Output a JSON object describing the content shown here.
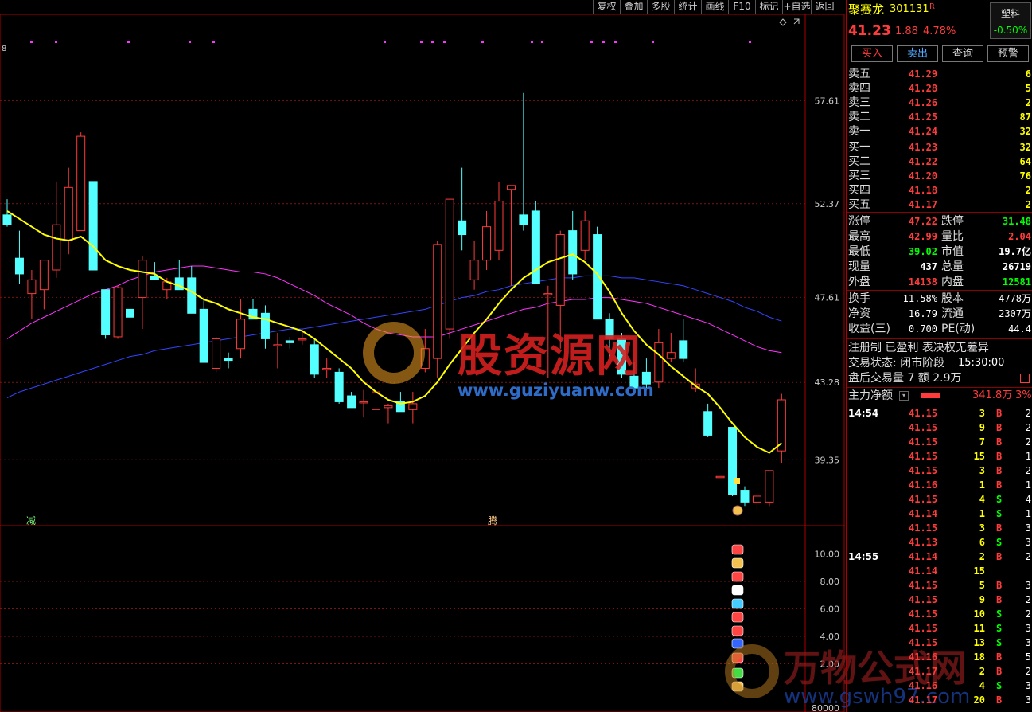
{
  "toolbar": {
    "items": [
      "复权",
      "叠加",
      "多股",
      "统计",
      "画线",
      "F10",
      "标记",
      "+自选",
      "返回"
    ]
  },
  "chart": {
    "top_left_digit": "8",
    "left_marker_label": "减",
    "mid_marker_label": "腾",
    "price_ticks": [
      "57.61",
      "52.37",
      "47.61",
      "43.28",
      "39.35"
    ],
    "sub_ticks": [
      "10.00",
      "8.00",
      "6.00",
      "4.00",
      "2.00",
      "80000"
    ],
    "colors": {
      "up": "#ff3b3b",
      "down": "#54ffff",
      "ma_short": "#ffff00",
      "ma_mid": "#ff33ff",
      "ma_long": "#3344ff",
      "grid": "#7a1414"
    }
  },
  "chart_data": {
    "type": "candlestick",
    "title": "",
    "ylim": [
      36.0,
      62.0
    ],
    "candles": [
      [
        51.8,
        52.6,
        51.2,
        51.3
      ],
      [
        49.6,
        51.0,
        48.3,
        48.8
      ],
      [
        47.8,
        49.0,
        46.5,
        48.5
      ],
      [
        48.0,
        49.5,
        47.0,
        49.5
      ],
      [
        49.0,
        53.5,
        48.6,
        51.3
      ],
      [
        50.5,
        54.2,
        49.8,
        53.2
      ],
      [
        51.0,
        56.0,
        51.0,
        55.8
      ],
      [
        53.5,
        53.5,
        49.0,
        49.0
      ],
      [
        48.0,
        48.0,
        45.5,
        45.7
      ],
      [
        45.6,
        48.2,
        45.5,
        48.1
      ],
      [
        47.0,
        47.5,
        46.0,
        46.6
      ],
      [
        47.6,
        49.7,
        46.0,
        49.5
      ],
      [
        48.7,
        49.4,
        48.5,
        48.5
      ],
      [
        48.0,
        48.6,
        47.5,
        48.4
      ],
      [
        48.6,
        49.5,
        48.0,
        48.0
      ],
      [
        48.6,
        49.2,
        46.8,
        46.8
      ],
      [
        47.0,
        47.5,
        44.3,
        44.3
      ],
      [
        44.0,
        45.6,
        43.8,
        45.5
      ],
      [
        44.5,
        44.8,
        44.0,
        44.4
      ],
      [
        45.0,
        47.5,
        44.5,
        46.5
      ],
      [
        47.0,
        47.5,
        46.5,
        46.5
      ],
      [
        46.8,
        47.2,
        45.0,
        45.5
      ],
      [
        45.2,
        45.8,
        44.0,
        45.2
      ],
      [
        45.4,
        45.6,
        45.0,
        45.3
      ],
      [
        45.5,
        46.0,
        45.2,
        45.5
      ],
      [
        45.2,
        45.5,
        43.5,
        43.7
      ],
      [
        44.0,
        44.5,
        43.5,
        44.0
      ],
      [
        43.8,
        44.0,
        42.2,
        42.3
      ],
      [
        42.6,
        42.8,
        42.0,
        42.0
      ],
      [
        42.3,
        42.9,
        41.5,
        42.3
      ],
      [
        41.9,
        42.8,
        41.7,
        42.8
      ],
      [
        42.0,
        42.2,
        41.2,
        42.1
      ],
      [
        42.3,
        42.8,
        41.8,
        41.8
      ],
      [
        41.9,
        42.8,
        41.2,
        42.2
      ],
      [
        44.0,
        46.0,
        43.8,
        45.0
      ],
      [
        44.5,
        50.5,
        43.5,
        50.3
      ],
      [
        46.0,
        52.6,
        45.5,
        52.6
      ],
      [
        51.5,
        54.2,
        50.0,
        50.8
      ],
      [
        48.5,
        50.5,
        48.0,
        49.5
      ],
      [
        49.5,
        52.0,
        49.0,
        51.2
      ],
      [
        50.0,
        53.5,
        49.5,
        52.5
      ],
      [
        53.1,
        53.2,
        48.2,
        53.3
      ],
      [
        51.8,
        58.0,
        51.0,
        51.3
      ],
      [
        52.0,
        52.5,
        48.3,
        48.3
      ],
      [
        47.8,
        48.2,
        43.5,
        47.8
      ],
      [
        47.2,
        51.0,
        45.0,
        50.8
      ],
      [
        51.0,
        52.0,
        48.5,
        48.8
      ],
      [
        50.0,
        52.0,
        49.5,
        51.5
      ],
      [
        50.8,
        51.2,
        46.5,
        46.5
      ],
      [
        46.5,
        46.8,
        44.5,
        45.5
      ],
      [
        45.5,
        45.8,
        43.5,
        43.7
      ],
      [
        43.6,
        44.3,
        43.0,
        43.0
      ],
      [
        43.8,
        44.5,
        43.0,
        43.2
      ],
      [
        43.3,
        46.0,
        43.0,
        45.3
      ],
      [
        44.5,
        45.8,
        44.3,
        44.8
      ],
      [
        45.4,
        46.5,
        44.3,
        44.5
      ],
      [
        43.0,
        44.0,
        42.8,
        43.2
      ],
      [
        41.8,
        42.2,
        40.5,
        40.6
      ],
      [
        38.5,
        38.5,
        38.5,
        38.5
      ],
      [
        41.0,
        41.0,
        37.5,
        37.6
      ],
      [
        37.8,
        38.0,
        37.0,
        37.2
      ],
      [
        37.2,
        37.6,
        36.8,
        37.5
      ],
      [
        37.2,
        38.8,
        37.0,
        38.8
      ],
      [
        39.8,
        42.7,
        39.2,
        42.4
      ]
    ],
    "ma_short": [
      52.0,
      51.6,
      51.2,
      50.8,
      50.6,
      50.5,
      50.7,
      50.2,
      49.5,
      49.2,
      49.0,
      48.9,
      48.8,
      48.4,
      48.2,
      47.9,
      47.5,
      47.3,
      47.0,
      46.8,
      46.6,
      46.5,
      46.3,
      46.1,
      45.9,
      45.5,
      45.0,
      44.5,
      44.0,
      43.3,
      42.8,
      42.4,
      42.2,
      42.3,
      42.6,
      43.3,
      44.2,
      45.0,
      45.8,
      46.5,
      47.3,
      48.0,
      48.6,
      49.0,
      49.4,
      49.6,
      49.8,
      49.4,
      48.8,
      47.9,
      46.8,
      45.9,
      45.2,
      44.7,
      44.1,
      43.6,
      43.1,
      42.7,
      42.0,
      41.2,
      40.5,
      40.0,
      39.7,
      40.2
    ],
    "ma_mid": [
      45.5,
      45.9,
      46.3,
      46.6,
      46.9,
      47.2,
      47.5,
      47.8,
      48.0,
      48.2,
      48.5,
      48.7,
      48.9,
      49.0,
      49.1,
      49.2,
      49.2,
      49.1,
      49.0,
      48.9,
      48.9,
      48.8,
      48.6,
      48.3,
      48.0,
      47.7,
      47.3,
      47.0,
      46.7,
      46.3,
      46.0,
      45.8,
      45.7,
      45.6,
      45.6,
      45.6,
      45.8,
      46.0,
      46.2,
      46.4,
      46.6,
      46.8,
      47.0,
      47.1,
      47.3,
      47.4,
      47.5,
      47.5,
      47.6,
      47.6,
      47.5,
      47.4,
      47.3,
      47.1,
      46.9,
      46.7,
      46.5,
      46.3,
      46.0,
      45.7,
      45.4,
      45.1,
      44.9,
      44.8
    ],
    "ma_long": [
      42.5,
      42.8,
      43.0,
      43.2,
      43.4,
      43.6,
      43.8,
      44.0,
      44.2,
      44.4,
      44.6,
      44.7,
      44.9,
      45.0,
      45.1,
      45.2,
      45.3,
      45.4,
      45.5,
      45.6,
      45.7,
      45.8,
      45.9,
      46.0,
      46.0,
      46.1,
      46.2,
      46.3,
      46.4,
      46.5,
      46.6,
      46.7,
      46.8,
      46.9,
      47.0,
      47.2,
      47.4,
      47.6,
      47.7,
      47.9,
      48.0,
      48.2,
      48.3,
      48.4,
      48.5,
      48.6,
      48.6,
      48.7,
      48.7,
      48.7,
      48.6,
      48.6,
      48.5,
      48.4,
      48.3,
      48.2,
      48.0,
      47.8,
      47.6,
      47.4,
      47.1,
      46.9,
      46.6,
      46.4
    ]
  },
  "panel": {
    "name": "聚赛龙",
    "code": "301131",
    "flag": "R",
    "sector": "塑料",
    "sector_change": "-0.50%",
    "price": "41.23",
    "change": "1.88",
    "change_pct": "4.78%",
    "buttons": [
      "买入",
      "卖出",
      "查询",
      "预警"
    ],
    "sell": [
      {
        "label": "卖五",
        "price": "41.29",
        "vol": "6"
      },
      {
        "label": "卖四",
        "price": "41.28",
        "vol": "5"
      },
      {
        "label": "卖三",
        "price": "41.26",
        "vol": "2"
      },
      {
        "label": "卖二",
        "price": "41.25",
        "vol": "87"
      },
      {
        "label": "卖一",
        "price": "41.24",
        "vol": "32"
      }
    ],
    "buy": [
      {
        "label": "买一",
        "price": "41.23",
        "vol": "32"
      },
      {
        "label": "买二",
        "price": "41.22",
        "vol": "64"
      },
      {
        "label": "买三",
        "price": "41.20",
        "vol": "76"
      },
      {
        "label": "买四",
        "price": "41.18",
        "vol": "2"
      },
      {
        "label": "买五",
        "price": "41.17",
        "vol": "2"
      }
    ],
    "stats": [
      {
        "l1": "涨停",
        "v1": "47.22",
        "c1": "red",
        "l2": "跌停",
        "v2": "31.48",
        "c2": "green"
      },
      {
        "l1": "最高",
        "v1": "42.99",
        "c1": "red",
        "l2": "量比",
        "v2": "2.04",
        "c2": "red"
      },
      {
        "l1": "最低",
        "v1": "39.02",
        "c1": "green",
        "l2": "市值",
        "v2": "19.7亿",
        "c2": "white"
      },
      {
        "l1": "现量",
        "v1": "437",
        "c1": "white",
        "l2": "总量",
        "v2": "26719",
        "c2": "white"
      },
      {
        "l1": "外盘",
        "v1": "14138",
        "c1": "red",
        "l2": "内盘",
        "v2": "12581",
        "c2": "green"
      }
    ],
    "stats2": [
      {
        "l1": "换手",
        "v1": "11.58%",
        "l2": "股本",
        "v2": "4778万"
      },
      {
        "l1": "净资",
        "v1": "16.79",
        "l2": "流通",
        "v2": "2307万"
      },
      {
        "l1": "收益(三)",
        "v1": "0.700",
        "l2": "PE(动)",
        "v2": "44.4"
      }
    ],
    "info1": "注册制 已盈利 表决权无差异",
    "info2_label": "交易状态: 闭市阶段",
    "info2_time": "15:30:00",
    "info3": "盘后交易量 7 额 2.9万",
    "main_flow_label": "主力净额",
    "main_flow_value": "341.8万",
    "main_flow_pct": "3%",
    "ticks": [
      {
        "t": "14:54",
        "p": "41.15",
        "v": "3",
        "s": "B",
        "n": "2"
      },
      {
        "t": "",
        "p": "41.15",
        "v": "9",
        "s": "B",
        "n": "2"
      },
      {
        "t": "",
        "p": "41.15",
        "v": "7",
        "s": "B",
        "n": "2"
      },
      {
        "t": "",
        "p": "41.15",
        "v": "15",
        "s": "B",
        "n": "1"
      },
      {
        "t": "",
        "p": "41.15",
        "v": "3",
        "s": "B",
        "n": "2"
      },
      {
        "t": "",
        "p": "41.16",
        "v": "1",
        "s": "B",
        "n": "1"
      },
      {
        "t": "",
        "p": "41.15",
        "v": "4",
        "s": "S",
        "n": "4"
      },
      {
        "t": "",
        "p": "41.14",
        "v": "1",
        "s": "S",
        "n": "1"
      },
      {
        "t": "",
        "p": "41.15",
        "v": "3",
        "s": "B",
        "n": "3"
      },
      {
        "t": "",
        "p": "41.13",
        "v": "6",
        "s": "S",
        "n": "3"
      },
      {
        "t": "14:55",
        "p": "41.14",
        "v": "2",
        "s": "B",
        "n": "2"
      },
      {
        "t": "",
        "p": "41.14",
        "v": "15",
        "s": "",
        "n": ""
      },
      {
        "t": "",
        "p": "41.15",
        "v": "5",
        "s": "B",
        "n": "3"
      },
      {
        "t": "",
        "p": "41.15",
        "v": "9",
        "s": "B",
        "n": "2"
      },
      {
        "t": "",
        "p": "41.15",
        "v": "10",
        "s": "S",
        "n": "2"
      },
      {
        "t": "",
        "p": "41.15",
        "v": "11",
        "s": "S",
        "n": "3"
      },
      {
        "t": "",
        "p": "41.15",
        "v": "13",
        "s": "S",
        "n": "3"
      },
      {
        "t": "",
        "p": "41.16",
        "v": "18",
        "s": "B",
        "n": "5"
      },
      {
        "t": "",
        "p": "41.17",
        "v": "2",
        "s": "B",
        "n": "2"
      },
      {
        "t": "",
        "p": "41.16",
        "v": "4",
        "s": "S",
        "n": "3"
      },
      {
        "t": "",
        "p": "41.17",
        "v": "20",
        "s": "B",
        "n": "3"
      }
    ]
  },
  "watermarks": {
    "w1": "股资源网",
    "w2": "www.guziyuanw.com",
    "w3": "万物公式网",
    "w4": "www.gswh97.com"
  }
}
